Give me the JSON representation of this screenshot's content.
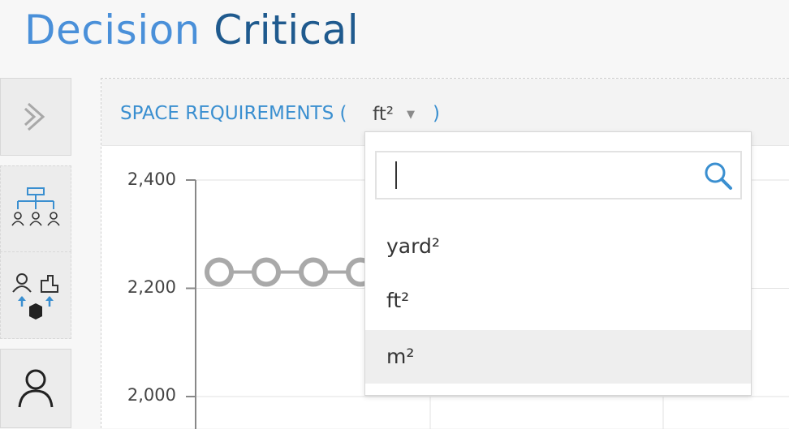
{
  "app": {
    "logo_word_1": "Decision",
    "logo_word_2": "Critical"
  },
  "sidebar": {
    "items": [
      {
        "name": "expand",
        "icon": "chevron-right-icon"
      },
      {
        "name": "org-chart",
        "icon": "org-chart-icon"
      },
      {
        "name": "people-facilities",
        "icon": "people-facility-transfer-icon"
      },
      {
        "name": "user",
        "icon": "user-icon"
      }
    ]
  },
  "panel": {
    "title": "SPACE REQUIREMENTS (",
    "unit_selected": "ft²",
    "close": ")",
    "accent_color": "#3a8fd0"
  },
  "chart_data": {
    "type": "line",
    "title": "SPACE REQUIREMENTS",
    "ylabel": "",
    "ytick_labels": [
      "2,400",
      "2,200",
      "2,000"
    ],
    "ylim": [
      2000,
      2400
    ],
    "grid": true,
    "series": [
      {
        "values": [
          2230,
          2230,
          2230,
          2230,
          2230,
          2230,
          2230,
          2230,
          2230,
          2230,
          2230,
          2230
        ],
        "color": "#a9a9a9"
      }
    ]
  },
  "dropdown": {
    "search_value": "",
    "search_icon": "search-icon",
    "options": [
      "yard²",
      "ft²",
      "m²"
    ],
    "highlighted_index": 2
  }
}
